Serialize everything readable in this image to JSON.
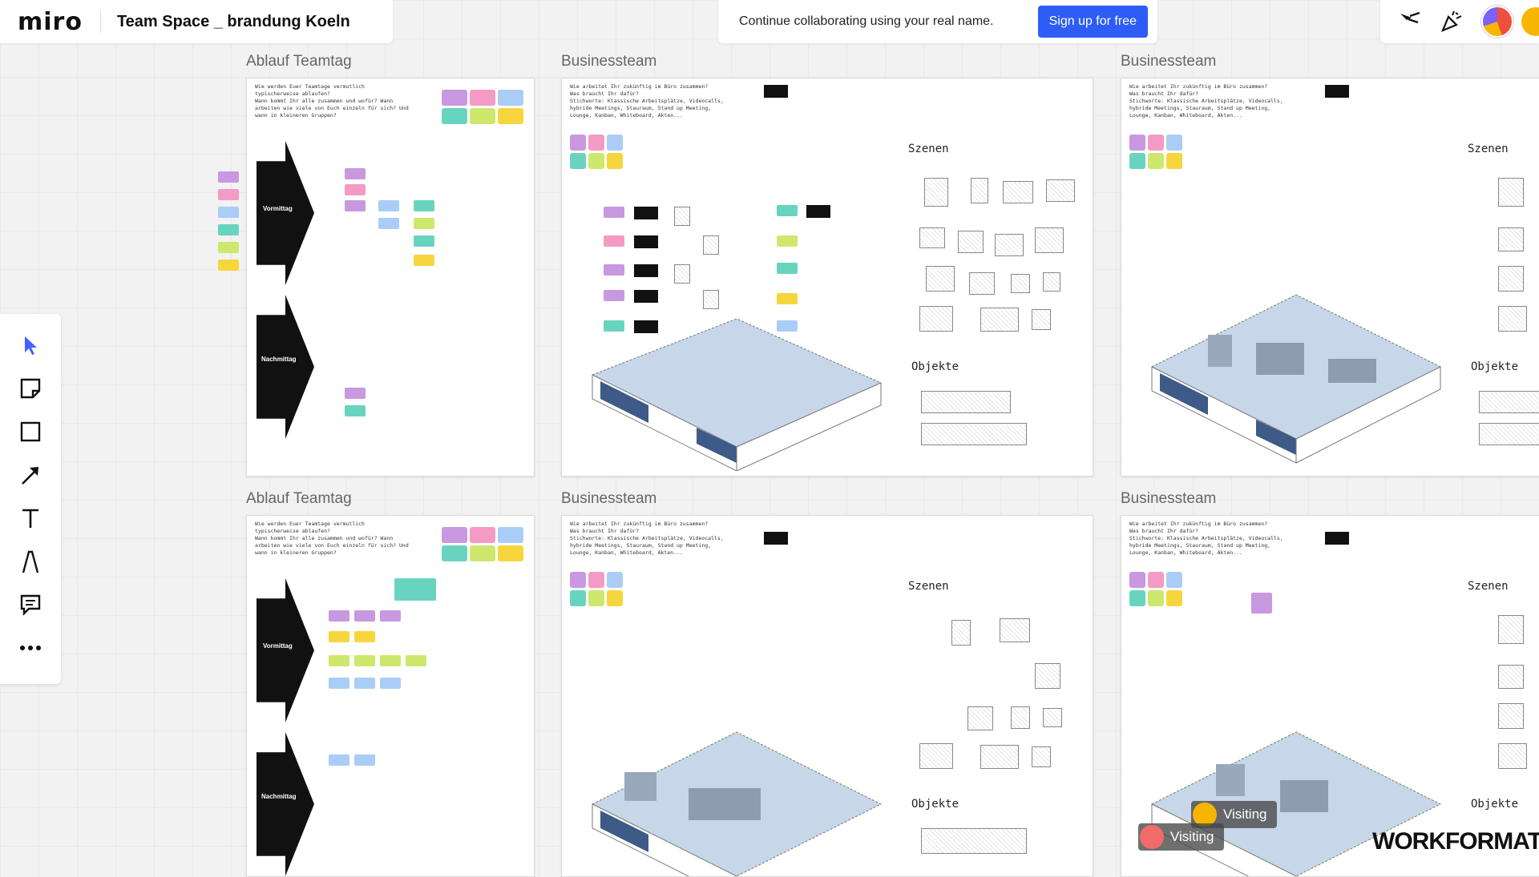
{
  "header": {
    "logo": "miro",
    "board_title": "Team Space _ brandung Koeln",
    "signup_text": "Continue collaborating using your real name.",
    "signup_button": "Sign up for free"
  },
  "toolbar": {
    "tools": [
      "select-pointer",
      "sticky-note",
      "shape",
      "connection-line",
      "text",
      "pen",
      "comment",
      "more"
    ]
  },
  "frames": {
    "f1": {
      "title": "Ablauf Teamtag"
    },
    "f2": {
      "title": "Businessteam"
    },
    "f3": {
      "title": "Businessteam"
    },
    "f4": {
      "title": "Ablauf Teamtag"
    },
    "f5": {
      "title": "Businessteam"
    },
    "f6": {
      "title": "Businessteam"
    }
  },
  "ablauf": {
    "question": "Wie werden Euer Teamtage vermutlich\ntypischerweise ablaufen?\nWann kommt Ihr alle zusammen und wofür? Wann\narbeiten wie viele von Euch einzeln für sich? Und\nwann in kleineren Gruppen?",
    "vormittag": "Vormittag",
    "nachmittag": "Nachmittag"
  },
  "business": {
    "question": "Wie arbeitet Ihr zukünftig im Büro zusammen?\nWas braucht Ihr dafür?\nStichworte: Klassische Arbeitsplätze, Videocalls,\nhybride Meetings, Stauraum, Stand up Meeting,\nLounge, Kanban, Whiteboard, Akten...",
    "szenen": "Szenen",
    "objekte": "Objekte"
  },
  "visitors": [
    {
      "label": "Visiting",
      "color": "#f7b500"
    },
    {
      "label": "Visiting",
      "color": "#f26b6b"
    }
  ],
  "watermark": "WORKFORMAT",
  "colors": {
    "accent": "#2d5cf6",
    "note_purple": "#c898e0",
    "note_pink": "#f39bc5",
    "note_blue": "#a9cdf7",
    "note_teal": "#68d4c0",
    "note_green": "#cde86c",
    "note_yellow": "#f7d63d",
    "floor": "#c7d6e8"
  }
}
